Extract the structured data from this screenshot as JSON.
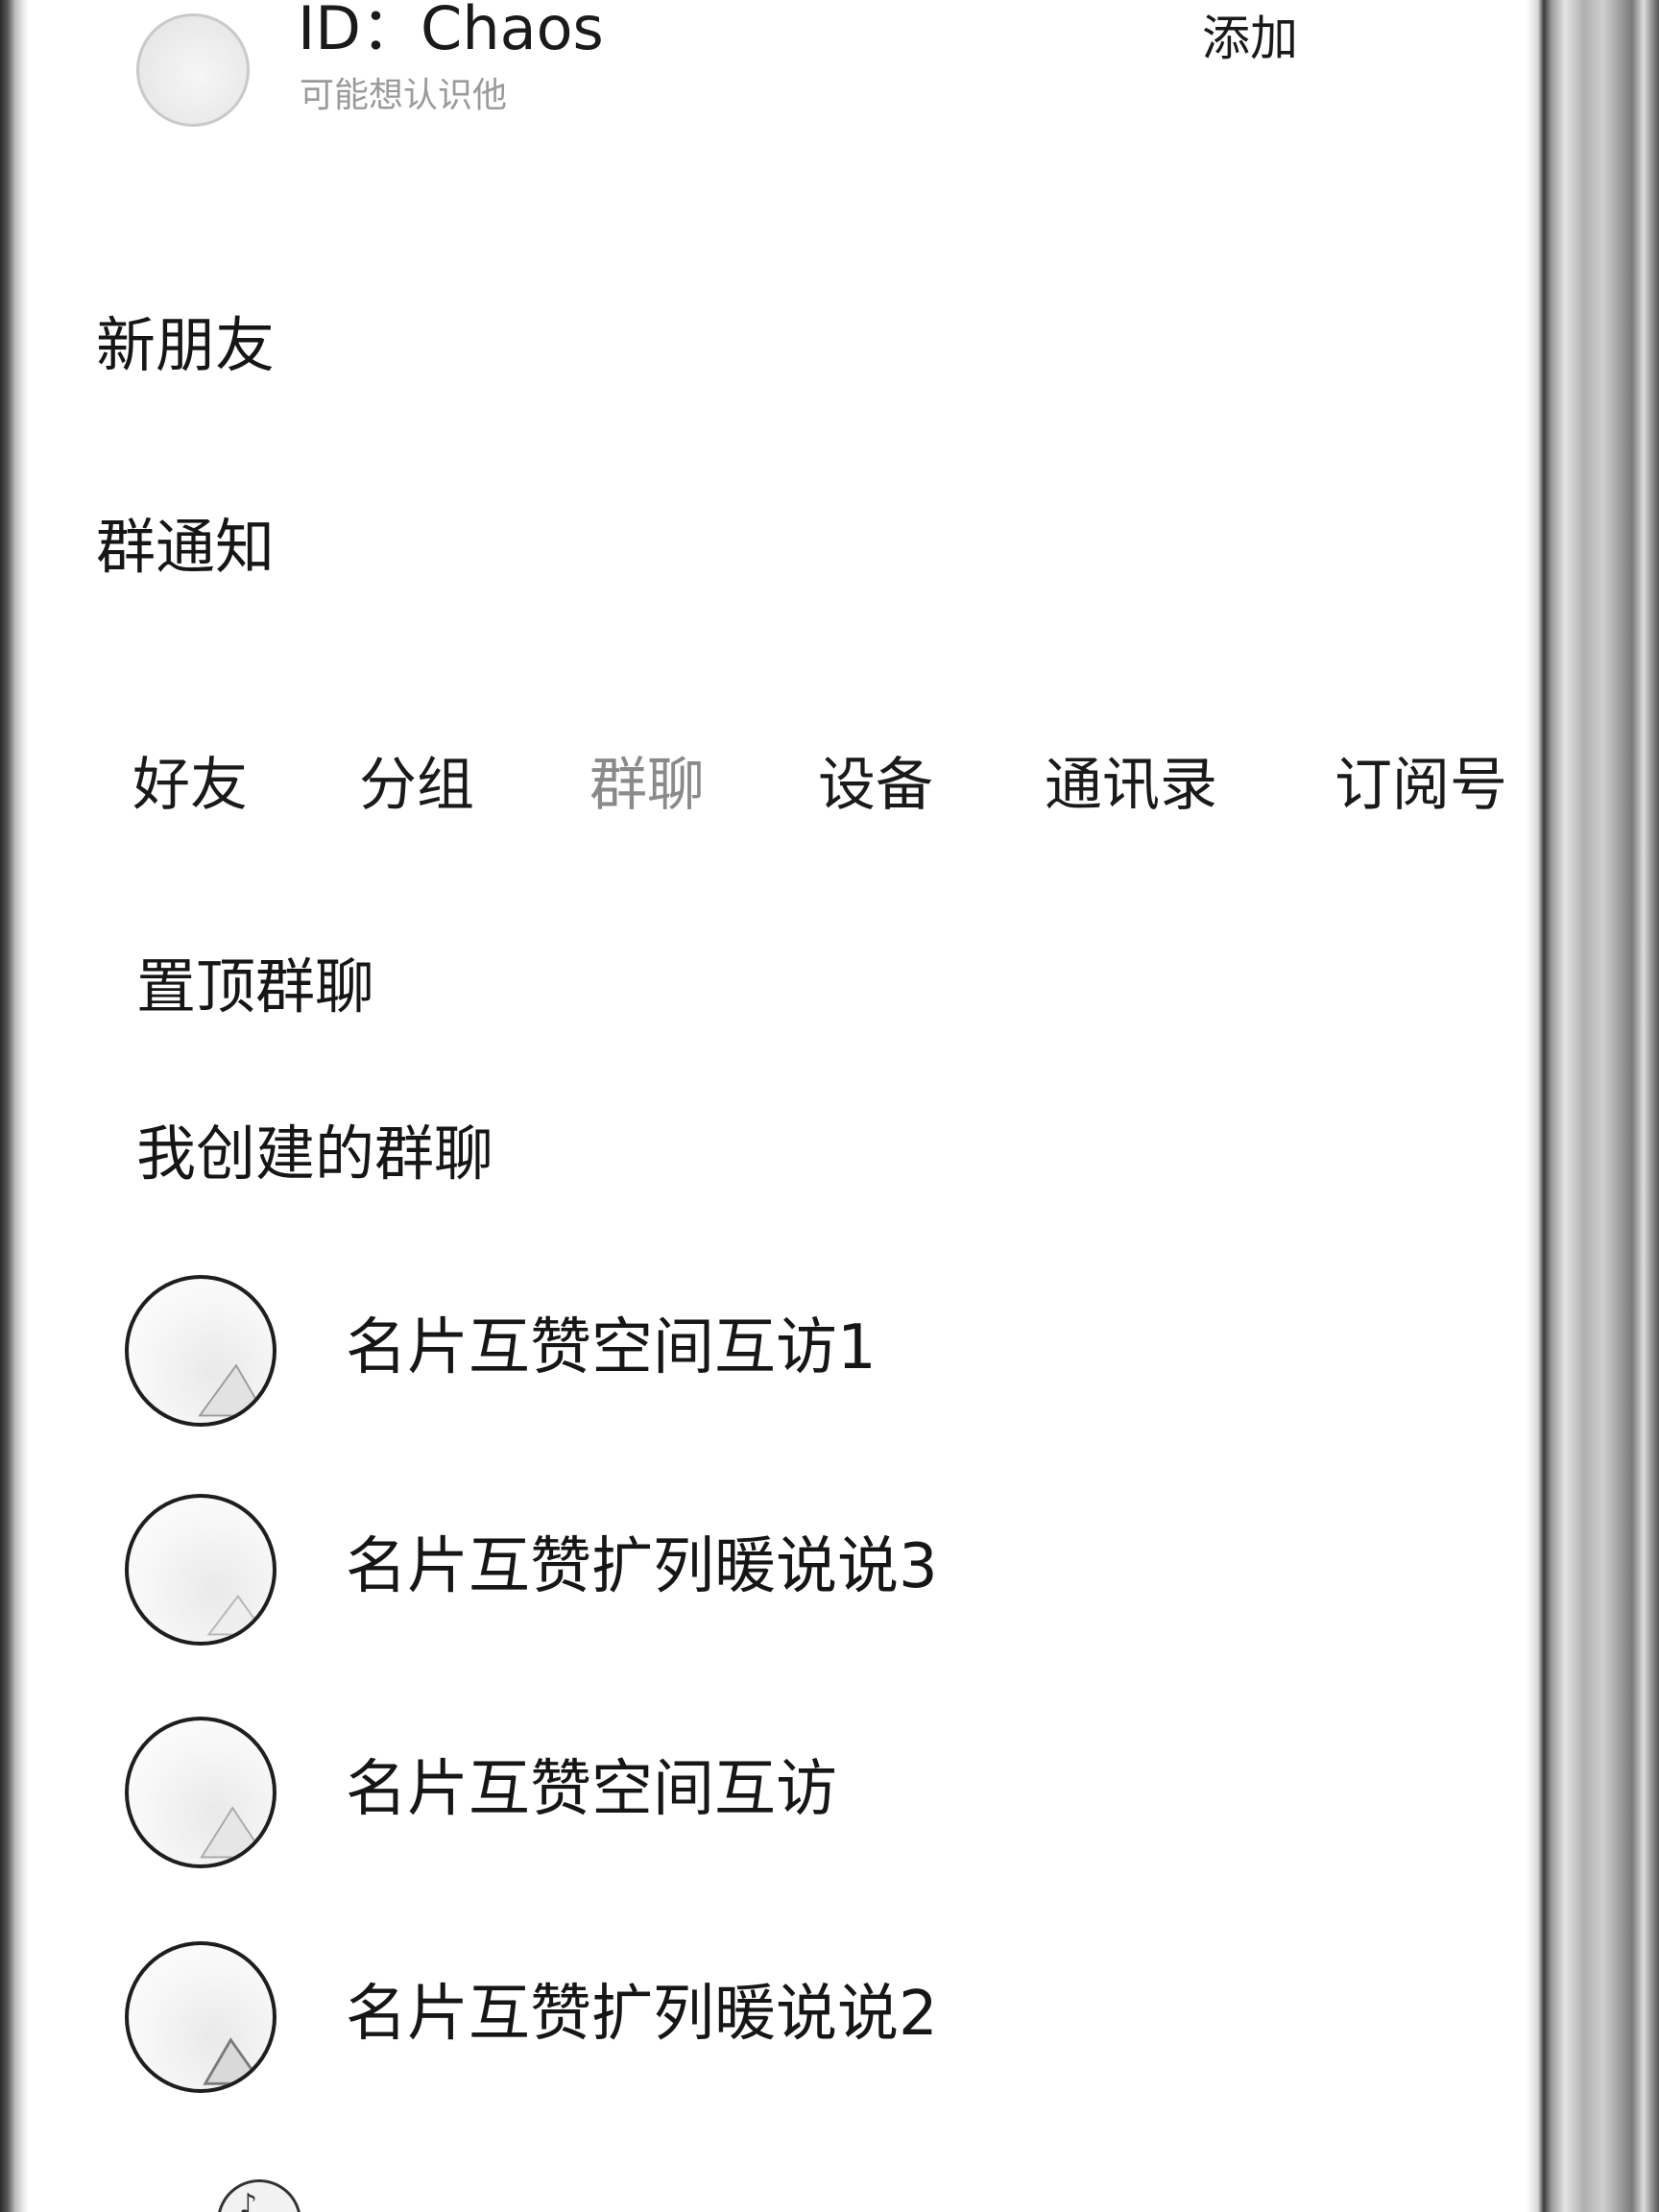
{
  "header": {
    "id_text": "ID：Chaos",
    "subtitle": "可能想认识他",
    "add_label": "添加"
  },
  "entries": {
    "new_friends": "新朋友",
    "group_notice": "群通知"
  },
  "tabs": [
    {
      "label": "好友"
    },
    {
      "label": "分组"
    },
    {
      "label": "群聊",
      "active": true
    },
    {
      "label": "设备"
    },
    {
      "label": "通讯录"
    },
    {
      "label": "订阅号"
    }
  ],
  "sections": {
    "pinned": "置顶群聊",
    "created": "我创建的群聊"
  },
  "groups": [
    {
      "name": "名片互赞空间互访1"
    },
    {
      "name": "名片互赞扩列暖说说3"
    },
    {
      "name": "名片互赞空间互访"
    },
    {
      "name": "名片互赞扩列暖说说2"
    }
  ]
}
